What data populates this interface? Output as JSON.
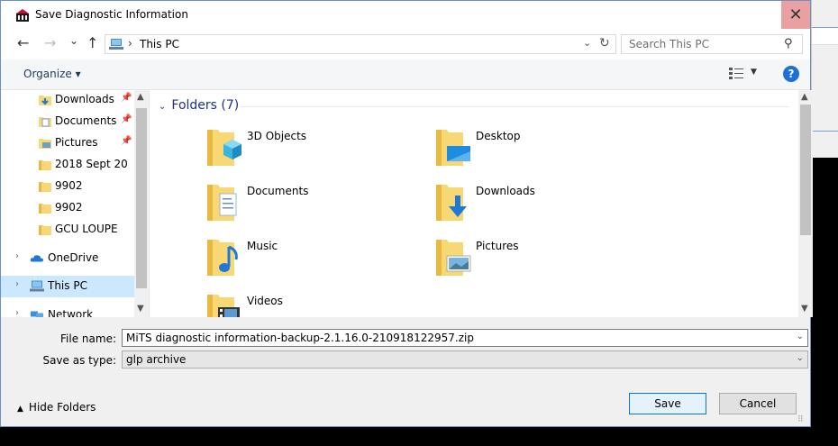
{
  "window": {
    "title": "Save Diagnostic Information",
    "close_glyph": "✕",
    "app_icon": "mits-logo-icon"
  },
  "nav": {
    "back_glyph": "←",
    "forward_glyph": "→",
    "recent_glyph": "⌄",
    "up_glyph": "↑",
    "address": {
      "breadcrumb_sep": "›",
      "location": "This PC",
      "dropdown_glyph": "⌄",
      "refresh_glyph": "↻"
    },
    "search": {
      "placeholder": "Search This PC",
      "icon_glyph": "⚲"
    }
  },
  "toolbar": {
    "organize_label": "Organize ▾",
    "view_dropdown_glyph": "▼",
    "help_label": "?"
  },
  "nav_pane": {
    "items": [
      {
        "label": "Downloads",
        "icon": "downloads-folder-icon",
        "pinned": true
      },
      {
        "label": "Documents",
        "icon": "documents-folder-icon",
        "pinned": true
      },
      {
        "label": "Pictures",
        "icon": "pictures-folder-icon",
        "pinned": true
      },
      {
        "label": "2018 Sept 20",
        "icon": "folder-icon",
        "pinned": false
      },
      {
        "label": "9902",
        "icon": "folder-icon",
        "pinned": false
      },
      {
        "label": "9902",
        "icon": "folder-icon",
        "pinned": false
      },
      {
        "label": "GCU LOUPE",
        "icon": "folder-icon",
        "pinned": false
      }
    ],
    "pin_glyph": "📌",
    "roots": [
      {
        "label": "OneDrive",
        "icon": "onedrive-cloud-icon",
        "expander": "›",
        "selected": false
      },
      {
        "label": "This PC",
        "icon": "this-pc-icon",
        "expander": "›",
        "selected": true
      },
      {
        "label": "Network",
        "icon": "network-icon",
        "expander": "›",
        "selected": false
      }
    ],
    "scroll_up": "▲",
    "scroll_down": "▼"
  },
  "content": {
    "group_label": "Folders (7)",
    "group_chevron": "⌄",
    "folders": [
      {
        "label": "3D Objects",
        "icon": "3d-objects-folder-icon"
      },
      {
        "label": "Desktop",
        "icon": "desktop-folder-icon"
      },
      {
        "label": "Documents",
        "icon": "documents-folder-icon"
      },
      {
        "label": "Downloads",
        "icon": "downloads-folder-icon"
      },
      {
        "label": "Music",
        "icon": "music-folder-icon"
      },
      {
        "label": "Pictures",
        "icon": "pictures-folder-icon"
      },
      {
        "label": "Videos",
        "icon": "videos-folder-icon"
      }
    ],
    "scroll_up": "▲",
    "scroll_down": "▼"
  },
  "form": {
    "file_name_label": "File name:",
    "file_name_value": "MiTS diagnostic information-backup-2.1.16.0-210918122957.zip",
    "save_as_type_label": "Save as type:",
    "save_as_type_value": "glp archive",
    "dropdown_glyph": "⌄"
  },
  "footer": {
    "hide_folders_label": "Hide Folders",
    "hide_folders_chevron": "▲",
    "save_label": "Save",
    "cancel_label": "Cancel",
    "grip_glyph": "⠿"
  },
  "colors": {
    "accent": "#0078d7",
    "selection": "#cce8ff",
    "close_hover": "#e8a0a0",
    "group_header": "#1e3287",
    "folder_yellow": "#f8d775"
  }
}
